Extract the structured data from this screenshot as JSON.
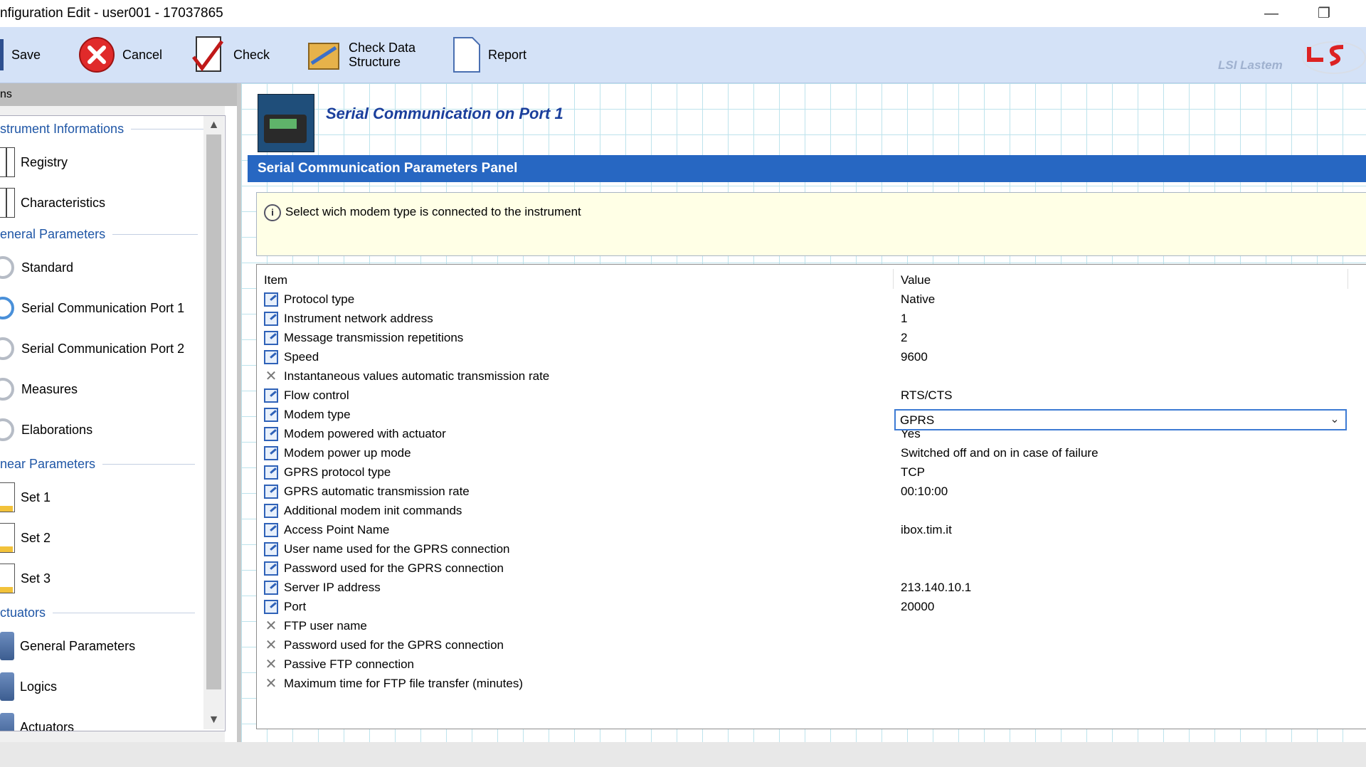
{
  "window": {
    "title": "nfiguration Edit - user001 - 17037865",
    "minimize_glyph": "—",
    "restore_glyph": "❐"
  },
  "toolbar": {
    "save": "Save",
    "cancel": "Cancel",
    "check": "Check",
    "check_data_1": "Check Data",
    "check_data_2": "Structure",
    "report": "Report",
    "brand": "LSI Lastem"
  },
  "sidebar": {
    "header": "ns",
    "groups": {
      "instrument": "strument Informations",
      "general": "eneral Parameters",
      "linear": "near Parameters",
      "actuators": "ctuators"
    },
    "items": [
      "Registry",
      "Characteristics",
      "Standard",
      "Serial Communication Port 1",
      "Serial Communication Port 2",
      "Measures",
      "Elaborations",
      "Set 1",
      "Set 2",
      "Set 3",
      "General Parameters",
      "Logics",
      "Actuators"
    ],
    "scroll_up": "▲",
    "scroll_down": "▼"
  },
  "page": {
    "title": "Serial Communication on Port 1",
    "panel_title": "Serial Communication Parameters Panel",
    "info_glyph": "i",
    "info_text": "Select wich modem type is connected to the instrument"
  },
  "grid": {
    "col_item": "Item",
    "col_value": "Value",
    "edit_icon_glyph": "",
    "disabled_icon_glyph": "✕",
    "rows": [
      {
        "name": "Protocol type",
        "value": "Native",
        "icon": "edit"
      },
      {
        "name": "Instrument network address",
        "value": "1",
        "icon": "edit"
      },
      {
        "name": "Message transmission repetitions",
        "value": "2",
        "icon": "edit"
      },
      {
        "name": "Speed",
        "value": "9600",
        "icon": "edit"
      },
      {
        "name": "Instantaneous values automatic transmission rate",
        "value": "",
        "icon": "disabled"
      },
      {
        "name": "Flow control",
        "value": "RTS/CTS",
        "icon": "edit"
      },
      {
        "name": "Modem type",
        "value": "",
        "icon": "edit"
      },
      {
        "name": "Modem powered with actuator",
        "value": "Yes",
        "icon": "edit"
      },
      {
        "name": "Modem power up mode",
        "value": "Switched off and on in case of failure",
        "icon": "edit"
      },
      {
        "name": "GPRS protocol type",
        "value": "TCP",
        "icon": "edit"
      },
      {
        "name": "GPRS automatic transmission rate",
        "value": "00:10:00",
        "icon": "edit"
      },
      {
        "name": "Additional modem init commands",
        "value": "",
        "icon": "edit"
      },
      {
        "name": "Access Point Name",
        "value": "ibox.tim.it",
        "icon": "edit"
      },
      {
        "name": "User name used for the GPRS connection",
        "value": "",
        "icon": "edit"
      },
      {
        "name": "Password used for the GPRS connection",
        "value": "",
        "icon": "edit"
      },
      {
        "name": "Server IP address",
        "value": "213.140.10.1",
        "icon": "edit"
      },
      {
        "name": "Port",
        "value": "20000",
        "icon": "edit"
      },
      {
        "name": "FTP user name",
        "value": "",
        "icon": "disabled"
      },
      {
        "name": "Password used for the GPRS connection",
        "value": "",
        "icon": "disabled"
      },
      {
        "name": "Passive FTP connection",
        "value": "",
        "icon": "disabled"
      },
      {
        "name": "Maximum time for FTP file transfer (minutes)",
        "value": "",
        "icon": "disabled"
      }
    ],
    "modem_combo": {
      "selected": "GPRS",
      "arrow": "⌄"
    }
  }
}
